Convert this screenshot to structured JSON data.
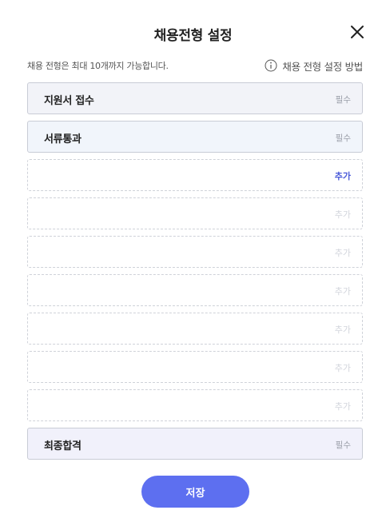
{
  "modal": {
    "title": "채용전형 설정",
    "helper_text": "채용 전형은 최대 10개까지 가능합니다.",
    "guide_link": "채용 전형 설정 방법",
    "save_label": "저장"
  },
  "stages": [
    {
      "label": "지원서 접수",
      "badge": "필수"
    },
    {
      "label": "서류통과",
      "badge": "필수"
    },
    {
      "add_label": "추가"
    },
    {
      "add_label": "추가"
    },
    {
      "add_label": "추가"
    },
    {
      "add_label": "추가"
    },
    {
      "add_label": "추가"
    },
    {
      "add_label": "추가"
    },
    {
      "add_label": "추가"
    },
    {
      "label": "최종합격",
      "badge": "필수"
    }
  ],
  "colors": {
    "accent": "#5d6ff0",
    "add_active": "#4b5bd9",
    "add_inactive": "#d2d5dc"
  },
  "icons": {
    "close": "close-icon",
    "info": "info-icon"
  }
}
